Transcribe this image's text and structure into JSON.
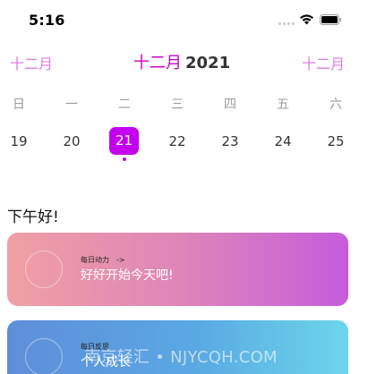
{
  "status_bar": {
    "time": "5:16"
  },
  "calendar": {
    "prev_month": "十二月",
    "month_name": "十二月",
    "year": "2021",
    "next_month": "十二月",
    "weekdays": [
      "日",
      "一",
      "二",
      "三",
      "四",
      "五",
      "六"
    ],
    "dates": [
      "19",
      "20",
      "21",
      "22",
      "23",
      "24",
      "25"
    ],
    "selected_date": "21",
    "accent_color": "#c400f0"
  },
  "greeting": "下午好!",
  "cards": [
    {
      "label": "每日动力",
      "arrow": "->",
      "title": "好好开始今天吧!",
      "gradient": [
        "#f0a0a4",
        "#c65cdc"
      ]
    },
    {
      "label": "每日反思",
      "title": "个人成长",
      "gradient": [
        "#5e8ed8",
        "#6cd6ea"
      ]
    }
  ],
  "watermark": "南京轻汇 • NJYCQH.COM"
}
